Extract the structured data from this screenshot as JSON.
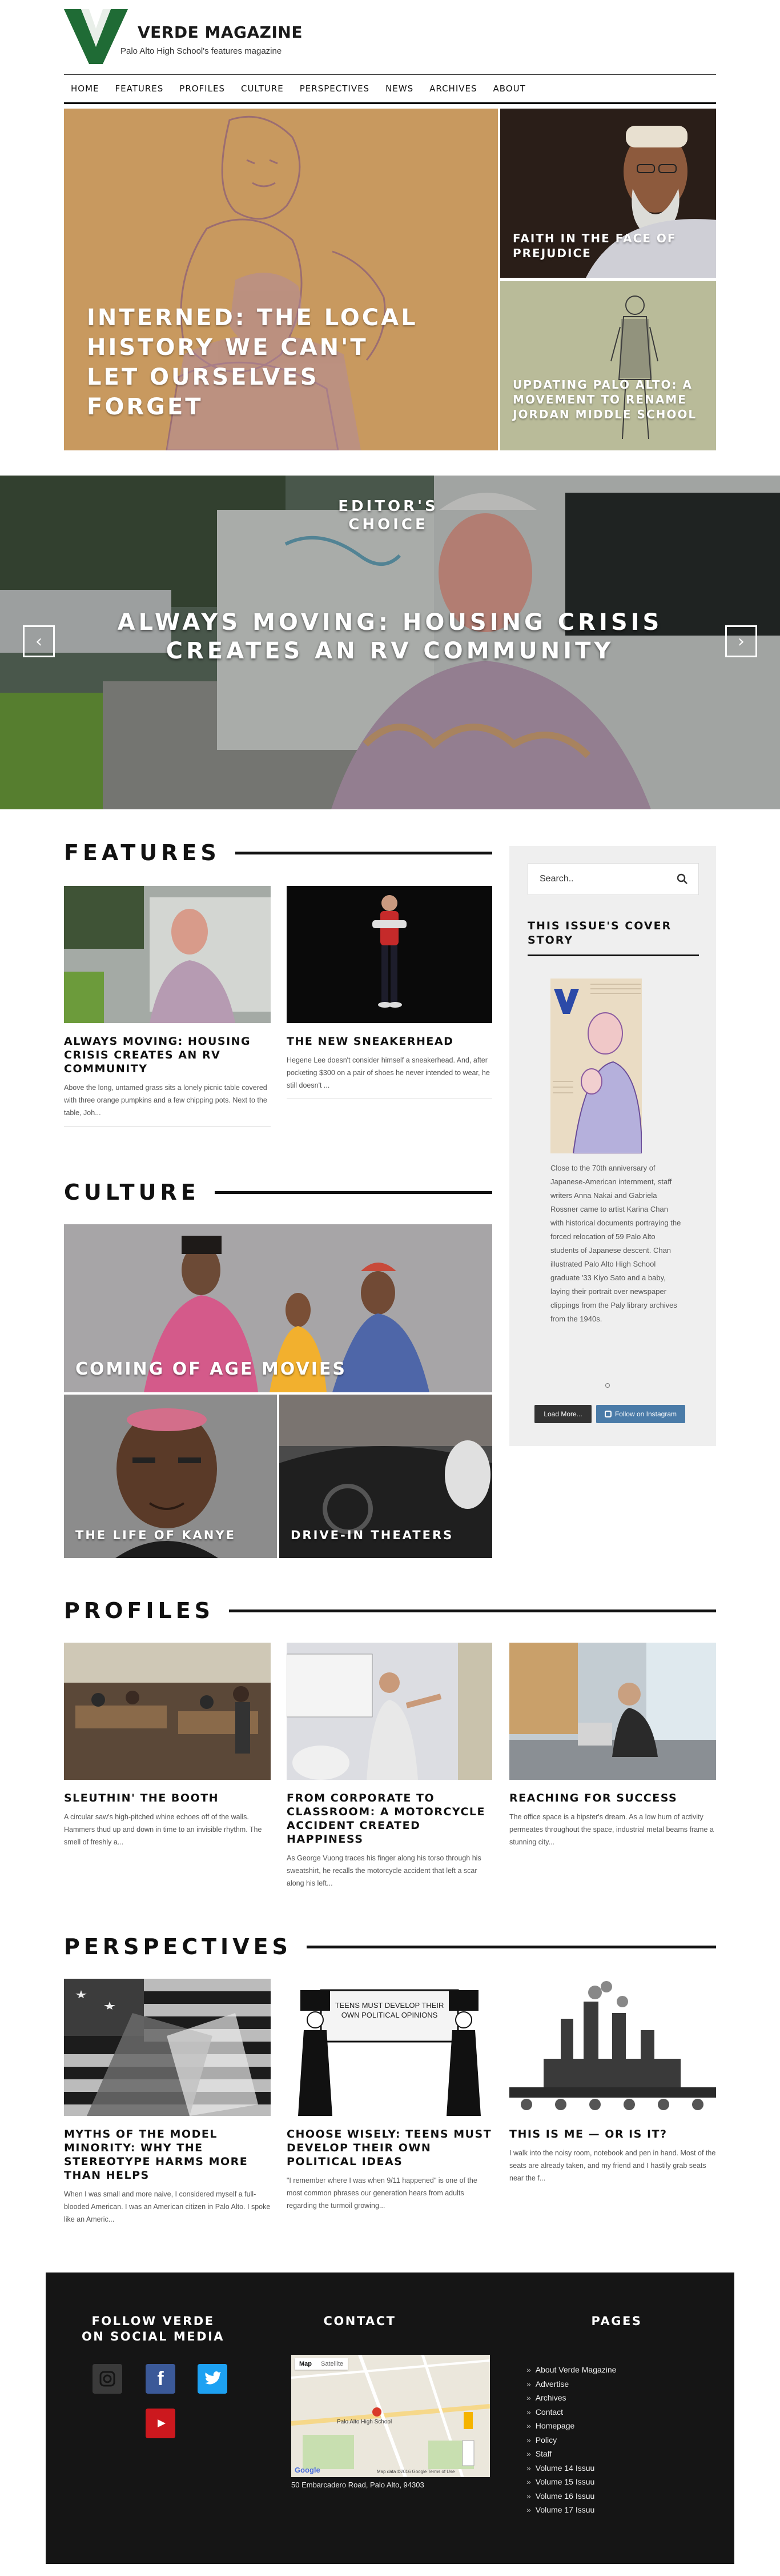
{
  "site": {
    "title": "VERDE MAGAZINE",
    "tagline": "Palo Alto High School's features magazine",
    "brand_green": "#1f6b35",
    "logo_letter": "V"
  },
  "nav": [
    "HOME",
    "FEATURES",
    "PROFILES",
    "CULTURE",
    "PERSPECTIVES",
    "NEWS",
    "ARCHIVES",
    "ABOUT"
  ],
  "hero": {
    "main_title": "INTERNED: THE LOCAL HISTORY WE CAN'T LET OURSELVES FORGET",
    "side_top_title": "FAITH IN THE FACE OF PREJUDICE",
    "side_bottom_title": "UPDATING PALO ALTO: A MOVEMENT TO RENAME JORDAN MIDDLE SCHOOL"
  },
  "editors_choice": {
    "label": "EDITOR'S CHOICE",
    "title": "ALWAYS MOVING: HOUSING CRISIS CREATES AN RV COMMUNITY",
    "prev_arrow": "‹",
    "next_arrow": "›"
  },
  "features": {
    "heading": "FEATURES",
    "cards": [
      {
        "title": "ALWAYS MOVING: HOUSING CRISIS CREATES AN RV COMMUNITY",
        "excerpt": "Above the long, untamed grass sits a lonely picnic table covered with three orange pumpkins and a few chipping pots. Next to the table, Joh..."
      },
      {
        "title": "THE NEW SNEAKERHEAD",
        "excerpt": "Hegene Lee doesn't consider himself a sneakerhead. And, after pocketing $300 on a pair of shoes he never intended to wear, he still doesn't ..."
      }
    ]
  },
  "sidebar": {
    "search_placeholder": "Search..",
    "cover_heading": "THIS ISSUE'S COVER STORY",
    "cover_caption": "Close to the 70th anniversary of Japanese-American internment, staff writers Anna Nakai and Gabriela Rossner came to artist Karina Chan with historical documents portraying the forced relocation of 59 Palo Alto students of Japanese descent. Chan illustrated Palo Alto High School graduate '33 Kiyo Sato and a baby, laying their portrait over newspaper clippings from the Paly library archives from the 1940s.",
    "load_more": "Load More...",
    "follow_instagram": "Follow on Instagram"
  },
  "culture": {
    "heading": "CULTURE",
    "tiles": [
      "COMING OF AGE MOVIES",
      "THE LIFE OF KANYE",
      "DRIVE-IN THEATERS"
    ]
  },
  "profiles": {
    "heading": "PROFILES",
    "cards": [
      {
        "title": "SLEUTHIN' THE BOOTH",
        "excerpt": "A circular saw's high-pitched whine echoes off of the walls. Hammers thud up and down in time to an invisible rhythm. The smell of freshly a..."
      },
      {
        "title": "FROM CORPORATE TO CLASSROOM: A MOTORCYCLE ACCIDENT CREATED HAPPINESS",
        "excerpt": "As George Vuong traces his finger along his torso through his sweatshirt, he recalls the motorcycle accident that left a scar along his left..."
      },
      {
        "title": "REACHING FOR SUCCESS",
        "excerpt": "The office space is a hipster's dream. As a low hum of activity permeates throughout the space, industrial metal beams frame a stunning city..."
      }
    ]
  },
  "perspectives": {
    "heading": "PERSPECTIVES",
    "sign_text": "TEENS MUST DEVELOP THEIR OWN POLITICAL OPINIONS",
    "cards": [
      {
        "title": "MYTHS OF THE MODEL MINORITY: WHY THE STEREOTYPE HARMS MORE THAN HELPS",
        "excerpt": "When I was small and more naive, I considered myself a full-blooded American. I was an American citizen in Palo Alto. I spoke like an Americ..."
      },
      {
        "title": "CHOOSE WISELY: TEENS MUST DEVELOP THEIR OWN POLITICAL IDEAS",
        "excerpt": "\"I remember where I was when 9/11 happened\" is one of the most common phrases our generation hears from adults regarding the turmoil growing..."
      },
      {
        "title": "THIS IS ME — OR IS IT?",
        "excerpt": "I walk into the noisy room, notebook and pen in hand. Most of the seats are already taken, and my friend and I hastily grab seats near the f..."
      }
    ]
  },
  "footer": {
    "follow_heading": "FOLLOW VERDE ON SOCIAL MEDIA",
    "contact_heading": "CONTACT",
    "pages_heading": "PAGES",
    "map_tabs": [
      "Map",
      "Satellite"
    ],
    "map_school_label": "Palo Alto High School",
    "map_credit": "Map data ©2016 Google  Terms of Use",
    "map_logo": "Google",
    "address": "50 Embarcadero Road, Palo Alto, 94303",
    "pages": [
      "About Verde Magazine",
      "Advertise",
      "Archives",
      "Contact",
      "Homepage",
      "Policy",
      "Staff",
      "Volume 14 Issuu",
      "Volume 15 Issuu",
      "Volume 16 Issuu",
      "Volume 17 Issuu"
    ],
    "social_colors": {
      "instagram": "#3a3a3a",
      "facebook": "#3b5998",
      "twitter": "#1da1f2",
      "youtube": "#cc181e"
    }
  }
}
